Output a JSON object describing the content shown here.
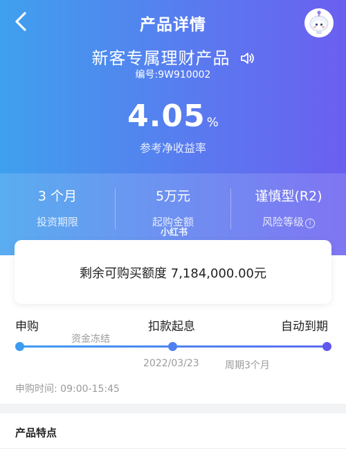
{
  "nav": {
    "title": "产品详情"
  },
  "product": {
    "name": "新客专属理财产品",
    "code": "编号:9W910002",
    "rate_value": "4.05",
    "rate_unit": "%",
    "rate_label": "参考净收益率"
  },
  "stats": [
    {
      "value": "3 个月",
      "label": "投资期限"
    },
    {
      "value": "5万元",
      "label": "起购金额"
    },
    {
      "value": "谨慎型(R2)",
      "label": "风险等级"
    }
  ],
  "watermark": "小红书",
  "quota": {
    "text": "剩余可购买额度 7,184,000.00元"
  },
  "timeline": {
    "steps": [
      "申购",
      "扣款起息",
      "自动到期"
    ],
    "freeze_label": "资金冻结",
    "date": "2022/03/23",
    "period": "周期3个月",
    "hours": "申购时间: 09:00-15:45"
  },
  "features": {
    "title": "产品特点"
  },
  "colors": {
    "gradient_start": "#3fa0ee",
    "gradient_end": "#6b5ff0",
    "dot_blue": "#3c9cf1",
    "dot_purple": "#6157ee"
  },
  "icons": {
    "back": "chevron-left-icon",
    "assistant": "robot-avatar-icon",
    "speaker": "speaker-icon",
    "info": "info-icon"
  }
}
